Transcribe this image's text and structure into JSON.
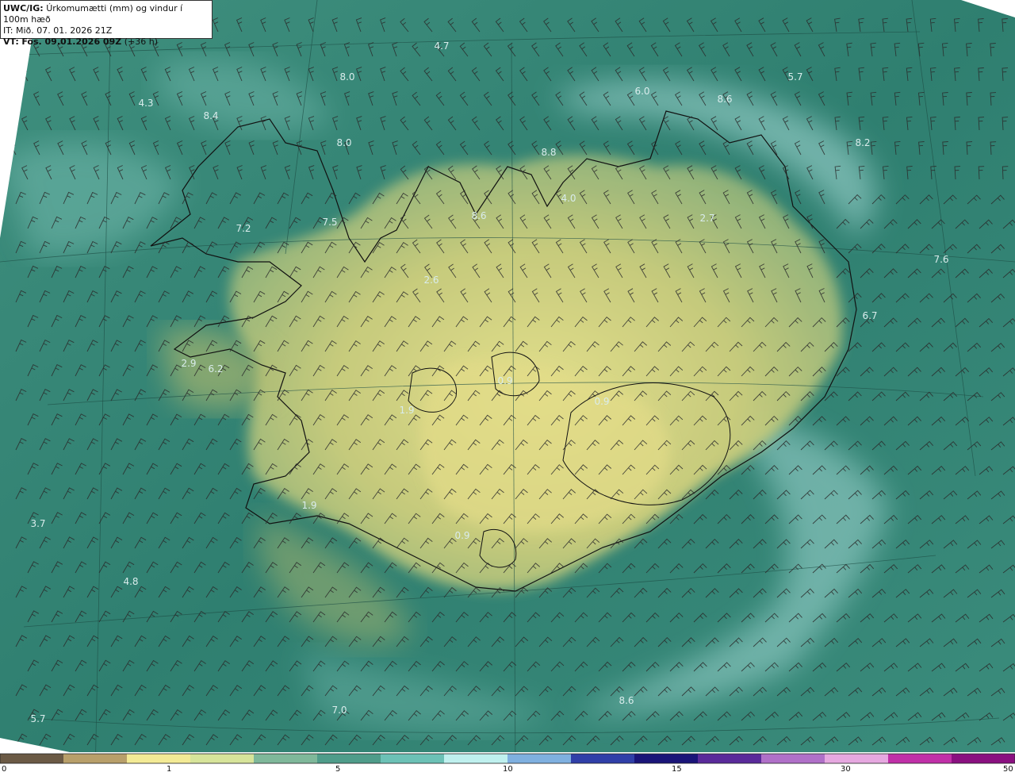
{
  "header": {
    "model_prefix": "UWC/IG:",
    "product_title": "Úrkomumætti (mm) og vindur í 100m hæð",
    "initial_time": "IT: Mið. 07. 01. 2026 21Z",
    "valid_prefix": "VT:",
    "valid_time": "Fös. 09.01.2026 09Z",
    "lead_time": "(+36 h)"
  },
  "map": {
    "colors": {
      "ocean_dark": "#2f7f70",
      "ocean_mid": "#4a9a88",
      "ocean_light": "#7fc3b8",
      "cloud_band": "#a9ddd9",
      "land_yellow": "#e3dc88",
      "land_olive": "#b9bd6e",
      "outside_domain": "#ffffff",
      "coastline": "#111111",
      "barb": "#2a2a2a"
    },
    "value_labels": [
      "4.7",
      "8.0",
      "5.7",
      "4.3",
      "8.4",
      "6.0",
      "8.6",
      "8.0",
      "8.8",
      "8.2",
      "7.2",
      "7.5",
      "8.6",
      "4.0",
      "2.7",
      "2.6",
      "7.6",
      "6.7",
      "2.9",
      "6.2",
      "0.9",
      "1.9",
      "0.9",
      "1.9",
      "3.7",
      "0.9",
      "4.8",
      "5.7",
      "7.0",
      "8.6"
    ]
  },
  "colorbar": {
    "ticks": [
      "0",
      "1",
      "5",
      "10",
      "15",
      "30",
      "50"
    ],
    "tick_values": [
      0,
      1,
      5,
      10,
      15,
      30,
      50
    ],
    "colors": [
      "#6b5a45",
      "#b89f6a",
      "#f3ea95",
      "#d7e49a",
      "#7fb89a",
      "#4f9c8a",
      "#6cc1b6",
      "#bff0ee",
      "#7fb0e0",
      "#303fa8",
      "#1a1478",
      "#5a2a9a",
      "#b070c8",
      "#e6a8e0",
      "#c030a8",
      "#8a1080"
    ]
  }
}
